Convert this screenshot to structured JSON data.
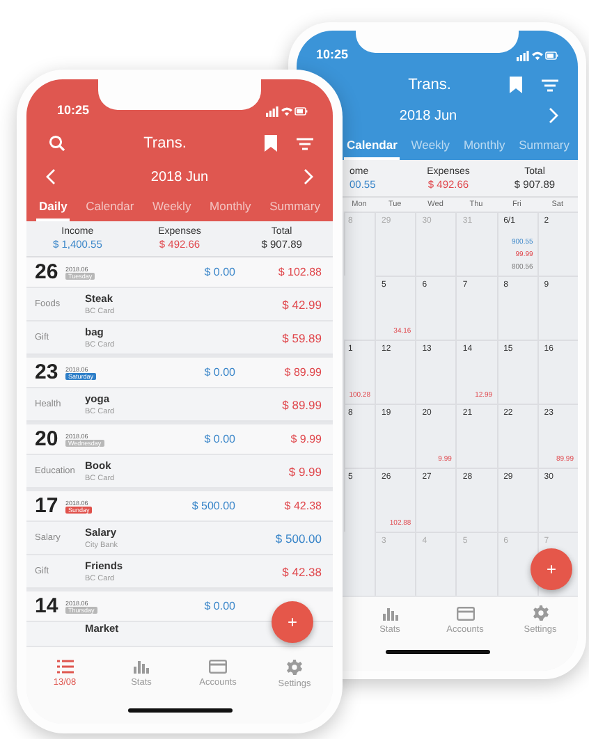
{
  "back_phone": {
    "status_bar": {
      "time": "10:25"
    },
    "header": {
      "title": "Trans.",
      "month": "2018 Jun"
    },
    "tabs": [
      {
        "label": "Calendar",
        "selected": true
      },
      {
        "label": "Weekly",
        "selected": false
      },
      {
        "label": "Monthly",
        "selected": false
      },
      {
        "label": "Summary",
        "selected": false
      }
    ],
    "summary": [
      {
        "label": "ome",
        "value": "00.55",
        "kind": "income"
      },
      {
        "label": "Expenses",
        "value": "$ 492.66",
        "kind": "expense"
      },
      {
        "label": "Total",
        "value": "$ 907.89",
        "kind": "total"
      }
    ],
    "calendar": {
      "weekdays": [
        "Mon",
        "Tue",
        "Wed",
        "Thu",
        "Fri",
        "Sat"
      ],
      "weeks": [
        {
          "monday": {
            "date": "8",
            "muted": true
          },
          "days": [
            {
              "date": "29",
              "muted": true
            },
            {
              "date": "30",
              "muted": true
            },
            {
              "date": "31",
              "muted": true
            },
            {
              "date": "6/1",
              "muted": false,
              "amounts": [
                {
                  "value": "900.55",
                  "kind": "income"
                },
                {
                  "value": "99.99",
                  "kind": "expense"
                },
                {
                  "value": "800.56",
                  "kind": "total"
                }
              ]
            },
            {
              "date": "2",
              "muted": false
            }
          ]
        },
        {
          "days": [
            {
              "date": "5",
              "muted": false,
              "amounts": [
                {
                  "value": "34.16",
                  "kind": "expense"
                }
              ]
            },
            {
              "date": "6",
              "muted": false
            },
            {
              "date": "7",
              "muted": false
            },
            {
              "date": "8",
              "muted": false
            },
            {
              "date": "9",
              "muted": false
            }
          ]
        },
        {
          "monday": {
            "date": "1",
            "muted": false,
            "amounts": [
              {
                "value": "100.28",
                "kind": "expense"
              }
            ]
          },
          "days": [
            {
              "date": "12",
              "muted": false
            },
            {
              "date": "13",
              "muted": false
            },
            {
              "date": "14",
              "muted": false,
              "amounts": [
                {
                  "value": "12.99",
                  "kind": "expense"
                }
              ]
            },
            {
              "date": "15",
              "muted": false
            },
            {
              "date": "16",
              "muted": false
            }
          ]
        },
        {
          "monday": {
            "date": "8",
            "muted": false
          },
          "days": [
            {
              "date": "19",
              "muted": false
            },
            {
              "date": "20",
              "muted": false,
              "amounts": [
                {
                  "value": "9.99",
                  "kind": "expense"
                }
              ]
            },
            {
              "date": "21",
              "muted": false
            },
            {
              "date": "22",
              "muted": false
            },
            {
              "date": "23",
              "muted": false,
              "amounts": [
                {
                  "value": "89.99",
                  "kind": "expense"
                }
              ]
            }
          ]
        },
        {
          "monday": {
            "date": "5",
            "muted": false
          },
          "days": [
            {
              "date": "26",
              "muted": false,
              "amounts": [
                {
                  "value": "102.88",
                  "kind": "expense"
                }
              ]
            },
            {
              "date": "27",
              "muted": false
            },
            {
              "date": "28",
              "muted": false
            },
            {
              "date": "29",
              "muted": false
            },
            {
              "date": "30",
              "muted": false
            }
          ]
        },
        {
          "days": [
            {
              "date": "3",
              "muted": true
            },
            {
              "date": "4",
              "muted": true
            },
            {
              "date": "5",
              "muted": true
            },
            {
              "date": "6",
              "muted": true
            },
            {
              "date": "7",
              "muted": true
            }
          ]
        }
      ]
    },
    "fab": "+",
    "nav": [
      {
        "label": "Stats",
        "kind": "stats",
        "selected": false
      },
      {
        "label": "Accounts",
        "kind": "accounts",
        "selected": false
      },
      {
        "label": "Settings",
        "kind": "settings",
        "selected": false
      }
    ]
  },
  "front_phone": {
    "status_bar": {
      "time": "10:25"
    },
    "header": {
      "title": "Trans.",
      "month": "2018 Jun"
    },
    "tabs": [
      {
        "label": "Daily",
        "selected": true
      },
      {
        "label": "Calendar",
        "selected": false
      },
      {
        "label": "Weekly",
        "selected": false
      },
      {
        "label": "Monthly",
        "selected": false
      },
      {
        "label": "Summary",
        "selected": false
      }
    ],
    "summary": [
      {
        "label": "Income",
        "value": "$ 1,400.55",
        "kind": "income"
      },
      {
        "label": "Expenses",
        "value": "$ 492.66",
        "kind": "expense"
      },
      {
        "label": "Total",
        "value": "$ 907.89",
        "kind": "total"
      }
    ],
    "days": [
      {
        "day": "26",
        "month": "2018.06",
        "weekday": "Tuesday",
        "color": "#b8b8b8",
        "income": "$ 0.00",
        "expense": "$ 102.88",
        "items": [
          {
            "category": "Foods",
            "name": "Steak",
            "account": "BC Card",
            "amount": "$ 42.99",
            "kind": "expense"
          },
          {
            "category": "Gift",
            "name": "bag",
            "account": "BC Card",
            "amount": "$ 59.89",
            "kind": "expense"
          }
        ]
      },
      {
        "day": "23",
        "month": "2018.06",
        "weekday": "Saturday",
        "color": "#2f7fc8",
        "income": "$ 0.00",
        "expense": "$ 89.99",
        "items": [
          {
            "category": "Health",
            "name": "yoga",
            "account": "BC Card",
            "amount": "$ 89.99",
            "kind": "expense"
          }
        ]
      },
      {
        "day": "20",
        "month": "2018.06",
        "weekday": "Wednesday",
        "color": "#b8b8b8",
        "income": "$ 0.00",
        "expense": "$ 9.99",
        "items": [
          {
            "category": "Education",
            "name": "Book",
            "account": "BC Card",
            "amount": "$ 9.99",
            "kind": "expense"
          }
        ]
      },
      {
        "day": "17",
        "month": "2018.06",
        "weekday": "Sunday",
        "color": "#e0504a",
        "income": "$ 500.00",
        "expense": "$ 42.38",
        "items": [
          {
            "category": "Salary",
            "name": "Salary",
            "account": "City Bank",
            "amount": "$ 500.00",
            "kind": "income"
          },
          {
            "category": "Gift",
            "name": "Friends",
            "account": "BC Card",
            "amount": "$ 42.38",
            "kind": "expense"
          }
        ]
      },
      {
        "day": "14",
        "month": "2018.06",
        "weekday": "Thursday",
        "color": "#b8b8b8",
        "income": "$ 0.00",
        "items": [
          {
            "name": "Market",
            "kind": "partial"
          }
        ]
      }
    ],
    "fab": "+",
    "nav": [
      {
        "label": "13/08",
        "kind": "list",
        "selected": true
      },
      {
        "label": "Stats",
        "kind": "stats",
        "selected": false
      },
      {
        "label": "Accounts",
        "kind": "accounts",
        "selected": false
      },
      {
        "label": "Settings",
        "kind": "settings",
        "selected": false
      }
    ]
  }
}
